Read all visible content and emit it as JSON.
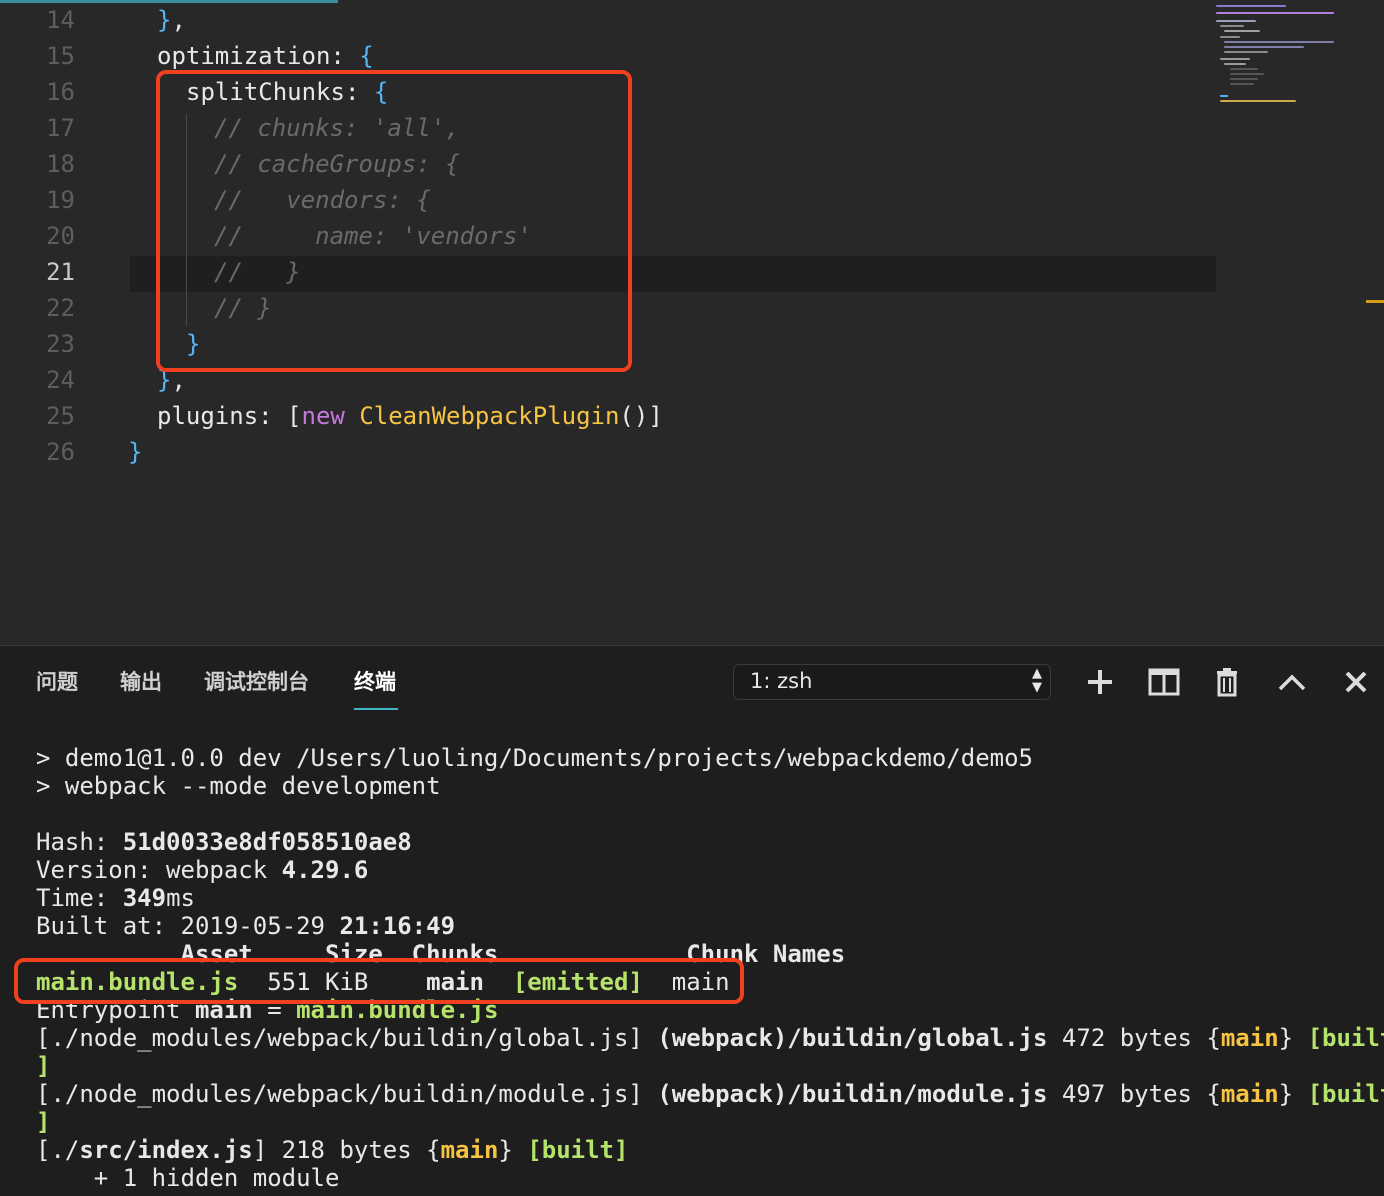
{
  "editor": {
    "lines": [
      {
        "num": "14",
        "code": "},"
      },
      {
        "num": "15",
        "code": "optimization: {"
      },
      {
        "num": "16",
        "code": "splitChunks: {"
      },
      {
        "num": "17",
        "code": "// chunks: 'all',"
      },
      {
        "num": "18",
        "code": "// cacheGroups: {"
      },
      {
        "num": "19",
        "code": "//   vendors: {"
      },
      {
        "num": "20",
        "code": "//     name: 'vendors'"
      },
      {
        "num": "21",
        "code": "//   }"
      },
      {
        "num": "22",
        "code": "// }"
      },
      {
        "num": "23",
        "code": "}"
      },
      {
        "num": "24",
        "code": "},"
      },
      {
        "num": "25",
        "code": "plugins: [new CleanWebpackPlugin()]"
      },
      {
        "num": "26",
        "code": "}"
      }
    ],
    "active_line": "21",
    "tokens": {
      "new_kw": "new",
      "class_name": "CleanWebpackPlugin",
      "plugins_key": "plugins",
      "optimization_key": "optimization",
      "splitchunks_key": "splitChunks"
    }
  },
  "panel": {
    "tabs": [
      "问题",
      "输出",
      "调试控制台",
      "终端"
    ],
    "active_tab": "终端",
    "terminal_select": "1: zsh",
    "icons": [
      "plus-icon",
      "split-icon",
      "trash-icon",
      "chevron-up-icon",
      "close-icon"
    ]
  },
  "terminal": {
    "cmd1": "> demo1@1.0.0 dev /Users/luoling/Documents/projects/webpackdemo/demo5",
    "cmd2": "> webpack --mode development",
    "hash_label": "Hash: ",
    "hash_value": "51d0033e8df058510ae8",
    "version_label": "Version: webpack ",
    "version_value": "4.29.6",
    "time_label": "Time: ",
    "time_value": "349",
    "time_unit": "ms",
    "built_label": "Built at: 2019-05-29 ",
    "built_time": "21:16:49",
    "table_header": "          Asset     Size  Chunks             Chunk Names",
    "asset_name": "main.bundle.js",
    "asset_size": "  551 KiB    ",
    "asset_chunk": "main",
    "asset_emitted": "[emitted]",
    "asset_chunkname": "  main",
    "entrypoint_label": "Entrypoint ",
    "entrypoint_main": "main",
    "entrypoint_eq": " = ",
    "entrypoint_file": "main.bundle.js",
    "mod1_path": "[./node_modules/webpack/buildin/global.js] ",
    "mod1_name": "(webpack)/buildin/global.js",
    "mod1_size": " 472 bytes {",
    "mod2_path": "[./node_modules/webpack/buildin/module.js] ",
    "mod2_name": "(webpack)/buildin/module.js",
    "mod2_size": " 497 bytes {",
    "mod3_open": "[./",
    "mod3_path": "src/index.js",
    "mod3_size": "] 218 bytes {",
    "chunk_main": "main",
    "close_brace": "} ",
    "built_tag_open": "[built",
    "built_tag_close": "]",
    "built_full": "[built]",
    "hidden_line": "    + 1 hidden module"
  },
  "colors": {
    "highlight_box": "#f0401f",
    "chunk_green": "#b5e36b",
    "chunk_yellow": "#f6c343",
    "brace_blue": "#56b6f7"
  }
}
